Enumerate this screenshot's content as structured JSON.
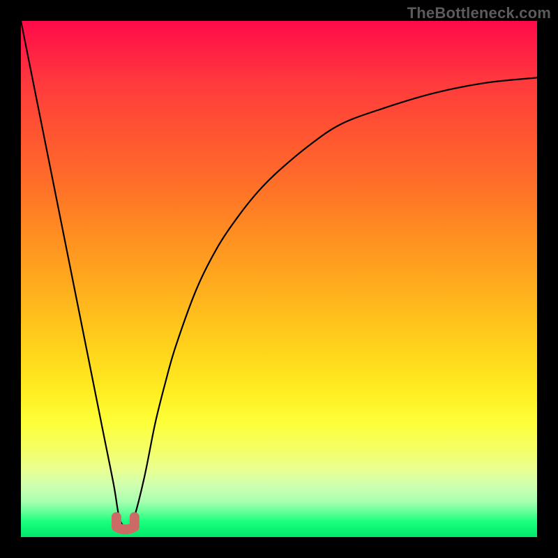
{
  "watermark": "TheBottleneck.com",
  "colors": {
    "frame": "#000000",
    "curve": "#000000",
    "marker": "#cc6a66",
    "gradient_top": "#ff0a4a",
    "gradient_bottom": "#00e86c"
  },
  "chart_data": {
    "type": "line",
    "title": "",
    "xlabel": "",
    "ylabel": "",
    "xlim": [
      0,
      100
    ],
    "ylim": [
      0,
      100
    ],
    "grid": false,
    "legend": false,
    "series": [
      {
        "name": "bottleneck-curve",
        "x": [
          0,
          2,
          4,
          6,
          8,
          10,
          12,
          14,
          16,
          18,
          19,
          20,
          21,
          22,
          24,
          26,
          28,
          30,
          34,
          38,
          42,
          46,
          50,
          56,
          62,
          70,
          80,
          90,
          100
        ],
        "y": [
          100,
          90,
          80,
          70,
          60,
          50,
          40,
          30,
          20,
          10,
          4,
          2,
          2,
          4,
          12,
          22,
          30,
          37,
          48,
          56,
          62,
          67,
          71,
          76,
          80,
          83,
          86,
          88,
          89
        ]
      }
    ],
    "annotations": [
      {
        "name": "min-marker",
        "shape": "u",
        "x_range": [
          18.5,
          22
        ],
        "y": 2,
        "color": "#cc6a66"
      }
    ],
    "background": {
      "type": "vertical-gradient",
      "meaning": "green (bottom) = good / low bottleneck, red (top) = bad / high bottleneck"
    }
  }
}
